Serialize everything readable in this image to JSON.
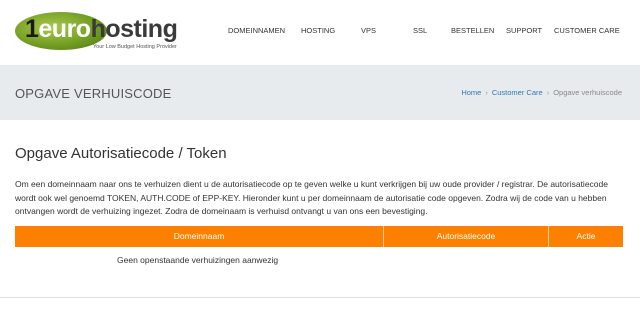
{
  "brand": {
    "logo_one": "1",
    "logo_euro": "euro",
    "logo_hosting": "hosting",
    "tagline": "Your Low Budget Hosting Provider",
    "accent_green": "#6e9a1f"
  },
  "nav": {
    "items": [
      "DOMEINNAMEN",
      "HOSTING",
      "VPS",
      "SSL",
      "BESTELLEN",
      "SUPPORT",
      "CUSTOMER CARE"
    ]
  },
  "titlebar": {
    "title": "OPGAVE VERHUISCODE",
    "breadcrumb": [
      "Home",
      "Customer Care",
      "Opgave verhuiscode"
    ]
  },
  "main": {
    "heading": "Opgave Autorisatiecode / Token",
    "intro": "Om een domeinnaam naar ons te verhuizen dient u de autorisatiecode op te geven welke u kunt verkrijgen bij uw oude provider / registrar. De autorisatiecode wordt ook wel genoemd TOKEN, AUTH.CODE of EPP-KEY. Hieronder kunt u per domeinnaam de autorisatie code opgeven. Zodra wij de code van u hebben ontvangen wordt de verhuizing ingezet. Zodra de domeinaam is verhuisd ontvangt u van ons een bevestiging."
  },
  "table": {
    "columns": [
      "Domeinnaam",
      "Autorisatiecode",
      "Actie"
    ],
    "empty_message": "Geen openstaande verhuizingen aanwezig",
    "header_color": "#ff7f00"
  }
}
